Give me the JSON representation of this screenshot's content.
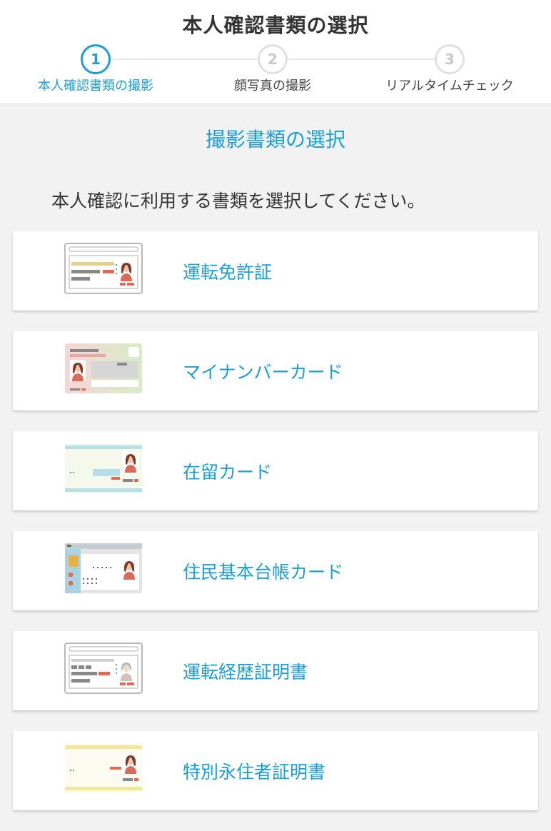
{
  "header": {
    "title": "本人確認書類の選択",
    "steps": [
      {
        "number": "1",
        "label": "本人確認書類の撮影",
        "active": true
      },
      {
        "number": "2",
        "label": "顔写真の撮影",
        "active": false
      },
      {
        "number": "3",
        "label": "リアルタイムチェック",
        "active": false
      }
    ]
  },
  "main": {
    "section_title": "撮影書類の選択",
    "instruction": "本人確認に利用する書類を選択してください。",
    "documents": [
      {
        "label": "運転免許証",
        "icon": "drivers-license-icon"
      },
      {
        "label": "マイナンバーカード",
        "icon": "my-number-card-icon"
      },
      {
        "label": "在留カード",
        "icon": "residence-card-icon"
      },
      {
        "label": "住民基本台帳カード",
        "icon": "resident-registry-card-icon"
      },
      {
        "label": "運転経歴証明書",
        "icon": "driving-history-certificate-icon"
      },
      {
        "label": "特別永住者証明書",
        "icon": "special-permanent-resident-certificate-icon"
      }
    ]
  },
  "colors": {
    "accent": "#1a9fd6",
    "text": "#333333",
    "background": "#f2f2f2",
    "card": "#ffffff"
  }
}
